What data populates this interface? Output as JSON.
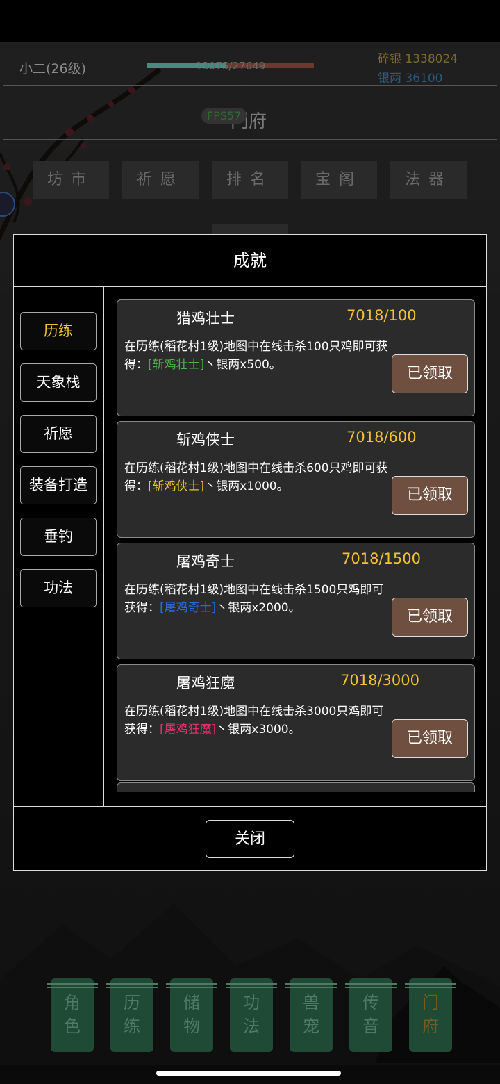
{
  "header": {
    "player_name": "小二(26级)",
    "exp_text": "13075/27649",
    "exp_progress": 0.47,
    "silver_fragments": "碎银 1338024",
    "silver_taels": "银两 36100",
    "fps_label": "FPS57",
    "page_title": "门府"
  },
  "top_nav": [
    {
      "label": "坊市"
    },
    {
      "label": "祈愿"
    },
    {
      "label": "排名"
    },
    {
      "label": "宝阁"
    },
    {
      "label": "法器"
    }
  ],
  "modal": {
    "title": "成就",
    "categories": [
      {
        "label": "历练",
        "active": true
      },
      {
        "label": "天象栈",
        "active": false
      },
      {
        "label": "祈愿",
        "active": false
      },
      {
        "label": "装备打造",
        "active": false
      },
      {
        "label": "垂钓",
        "active": false
      },
      {
        "label": "功法",
        "active": false
      }
    ],
    "achievements": [
      {
        "name": "猎鸡壮士",
        "progress": "7018/100",
        "desc_pre": "在历练(稻花村1级)地图中在线击杀100只鸡即可获得：",
        "reward": "[斩鸡壮士]",
        "desc_post": "丶银两x500。",
        "button": "已领取",
        "reward_color": "#4caf50"
      },
      {
        "name": "斩鸡侠士",
        "progress": "7018/600",
        "desc_pre": "在历练(稻花村1级)地图中在线击杀600只鸡即可获得：",
        "reward": "[斩鸡侠士]",
        "desc_post": "丶银两x1000。",
        "button": "已领取",
        "reward_color": "#f1c232"
      },
      {
        "name": "屠鸡奇士",
        "progress": "7018/1500",
        "desc_pre": "在历练(稻花村1级)地图中在线击杀1500只鸡即可获得：",
        "reward": "[屠鸡奇士]",
        "desc_post": "丶银两x2000。",
        "button": "已领取",
        "reward_color": "#2a6ad6"
      },
      {
        "name": "屠鸡狂魔",
        "progress": "7018/3000",
        "desc_pre": "在历练(稻花村1级)地图中在线击杀3000只鸡即可获得：",
        "reward": "[屠鸡狂魔]",
        "desc_post": "丶银两x3000。",
        "button": "已领取",
        "reward_color": "#e0306a"
      }
    ],
    "close_label": "关闭"
  },
  "bottom_nav": [
    {
      "label": "角色",
      "active": false
    },
    {
      "label": "历练",
      "active": false
    },
    {
      "label": "储物",
      "active": false
    },
    {
      "label": "功法",
      "active": false
    },
    {
      "label": "兽宠",
      "active": false
    },
    {
      "label": "传音",
      "active": false
    },
    {
      "label": "门府",
      "active": true
    }
  ]
}
